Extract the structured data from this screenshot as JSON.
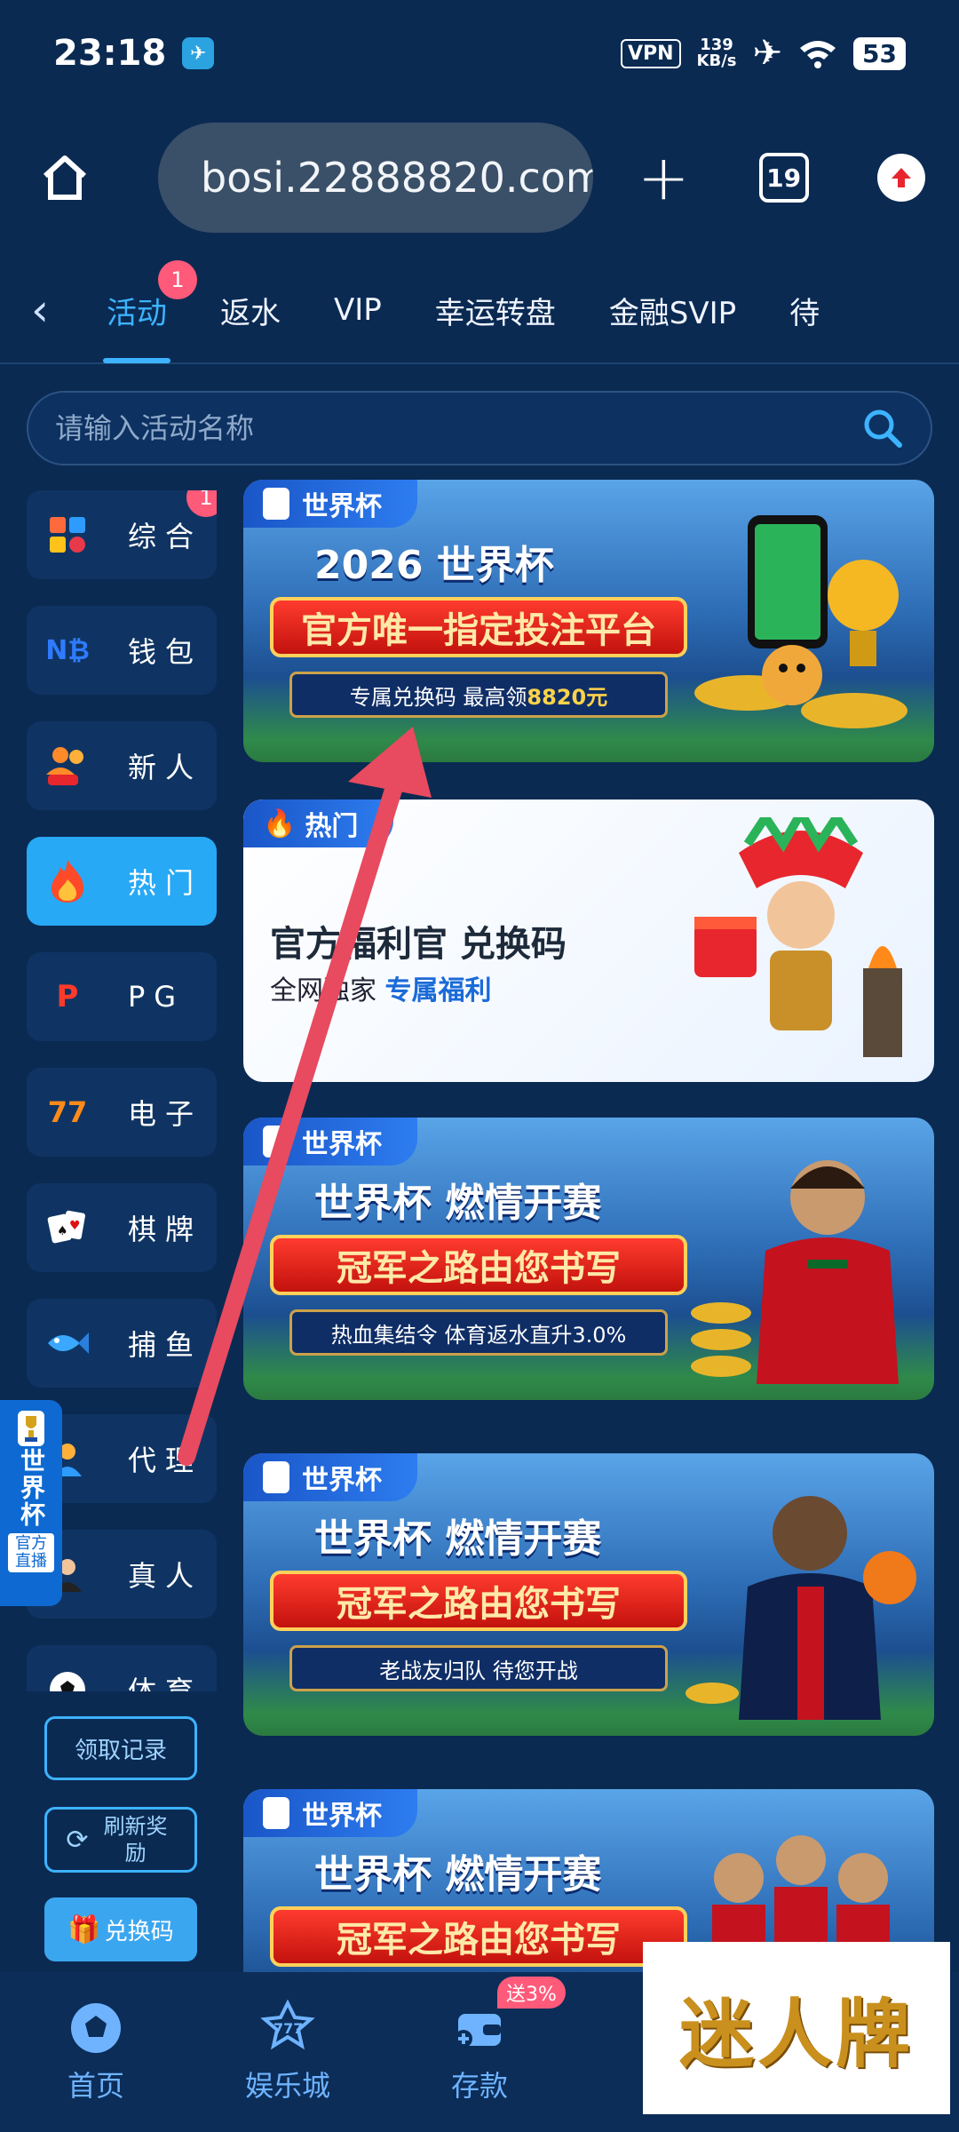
{
  "status_bar": {
    "time": "23:18",
    "vpn": "VPN",
    "net_speed": "139",
    "net_unit": "KB/s",
    "battery": "53"
  },
  "browser": {
    "url": "bosi.22888820.com",
    "tabs_count": "19"
  },
  "categories": [
    {
      "label": "活动",
      "active": true,
      "badge": "1"
    },
    {
      "label": "返水"
    },
    {
      "label": "VIP"
    },
    {
      "label": "幸运转盘"
    },
    {
      "label": "金融SVIP"
    },
    {
      "label": "待"
    }
  ],
  "search": {
    "placeholder": "请输入活动名称"
  },
  "sidebar": {
    "items": [
      {
        "label": "综合",
        "icon": "grid-icon",
        "badge": "1"
      },
      {
        "label": "钱包",
        "icon": "wallet-icon"
      },
      {
        "label": "新人",
        "icon": "new-user-icon"
      },
      {
        "label": "热门",
        "icon": "flame-icon",
        "active": true
      },
      {
        "label": "PG",
        "icon": "pg-icon"
      },
      {
        "label": "电子",
        "icon": "slot-777-icon"
      },
      {
        "label": "棋牌",
        "icon": "cards-icon"
      },
      {
        "label": "捕鱼",
        "icon": "fish-icon"
      },
      {
        "label": "代理",
        "icon": "agent-icon"
      },
      {
        "label": "真人",
        "icon": "live-icon"
      },
      {
        "label": "体育",
        "icon": "ball-icon"
      }
    ],
    "record_button": "领取记录",
    "refresh_button": "刷新奖励",
    "redeem_button": "兑换码"
  },
  "floating_badge": {
    "title": "世界杯",
    "subtitle": "官方直播"
  },
  "banners": [
    {
      "tag": "世界杯",
      "title": "2026 世界杯",
      "ribbon": "官方唯一指定投注平台",
      "sub": "专属兑换码 最高领",
      "sub_highlight": "8820元"
    },
    {
      "tag": "热门",
      "title": "官方福利官 兑换码",
      "sub": "全网独家",
      "sub_highlight": "专属福利"
    },
    {
      "tag": "世界杯",
      "title": "世界杯 燃情开赛",
      "ribbon": "冠军之路由您书写",
      "sub": "热血集结令 体育返水直升3.0%"
    },
    {
      "tag": "世界杯",
      "title": "世界杯 燃情开赛",
      "ribbon": "冠军之路由您书写",
      "sub": "老战友归队 待您开战"
    },
    {
      "tag": "世界杯",
      "title": "世界杯 燃情开赛",
      "ribbon": "冠军之路由您书写"
    }
  ],
  "bottom_nav": [
    {
      "label": "首页",
      "icon": "soccer-ball-icon"
    },
    {
      "label": "娱乐城",
      "icon": "casino-777-icon"
    },
    {
      "label": "存款",
      "icon": "deposit-icon",
      "badge": "送3%"
    }
  ],
  "watermark": "迷人牌",
  "colors": {
    "background": "#0a2a52",
    "accent": "#3db3ff",
    "badge": "#ff5a7a",
    "arrow": "#e84a5f"
  }
}
